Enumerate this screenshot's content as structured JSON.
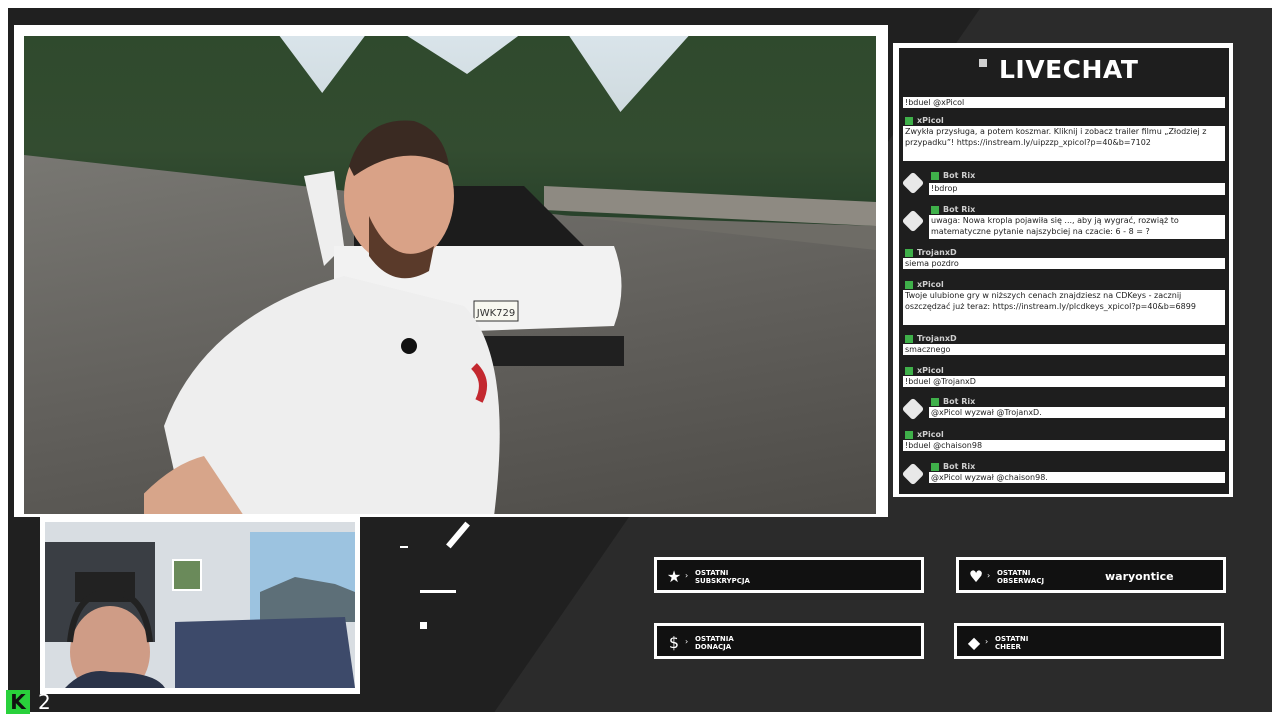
{
  "chat": {
    "title": "LIVECHAT",
    "messages": [
      {
        "user": "",
        "text": "!bduel @xPicol",
        "bot": false
      },
      {
        "user": "xPicol",
        "text": "Zwykła przysługa, a potem koszmar. Kliknij i zobacz trailer filmu „Złodziej z przypadku”! https://instream.ly/uipzzp_xpicol?p=40&b=7102",
        "bot": false
      },
      {
        "user": "Bot Rix",
        "text": "!bdrop",
        "bot": true
      },
      {
        "user": "Bot Rix",
        "text": "uwaga: Nowa kropla pojawiła się ..., aby ją wygrać, rozwiąż to matematyczne pytanie najszybciej na czacie: 6 - 8 = ?",
        "bot": true
      },
      {
        "user": "TrojanxD",
        "text": "siema pozdro",
        "bot": false
      },
      {
        "user": "xPicol",
        "text": "Twoje ulubione gry w niższych cenach znajdziesz na CDKeys - zacznij oszczędzać już teraz: https://instream.ly/plcdkeys_xpicol?p=40&b=6899",
        "bot": false
      },
      {
        "user": "TrojanxD",
        "text": "smacznego",
        "bot": false
      },
      {
        "user": "xPicol",
        "text": "!bduel @TrojanxD",
        "bot": false
      },
      {
        "user": "Bot Rix",
        "text": "@xPicol wyzwał @TrojanxD.",
        "bot": true
      },
      {
        "user": "xPicol",
        "text": "!bduel @chaison98",
        "bot": false
      },
      {
        "user": "Bot Rix",
        "text": "@xPicol wyzwał @chaison98.",
        "bot": true
      }
    ]
  },
  "boxes": {
    "sub": {
      "label_1": "OSTATNI",
      "label_2": "SUBSKRYPCJA",
      "value": "",
      "icon": "star-icon"
    },
    "follow": {
      "label_1": "OSTATNI",
      "label_2": "OBSERWACJ",
      "value": "waryontice",
      "icon": "heart-icon"
    },
    "donate": {
      "label_1": "OSTATNIA",
      "label_2": "DONACJA",
      "value": "",
      "icon": "dollar-icon"
    },
    "cheer": {
      "label_1": "OSTATNI",
      "label_2": "CHEER",
      "value": "",
      "icon": "diamond-icon"
    }
  },
  "footer": {
    "logo": "K",
    "viewer_count": "2"
  },
  "video": {
    "plate": "JWK729"
  }
}
